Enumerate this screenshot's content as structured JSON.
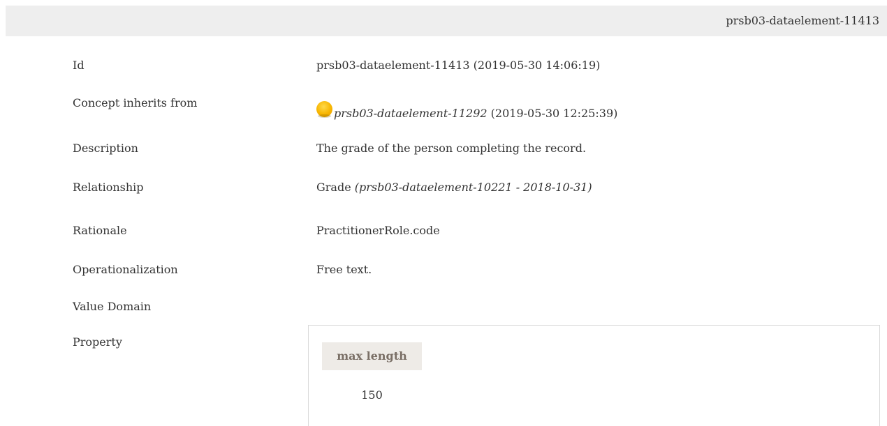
{
  "header": {
    "title": "prsb03-dataelement-11413"
  },
  "rows": {
    "id": {
      "label": "Id",
      "value": "prsb03-dataelement-11413 (2019-05-30 14:06:19)"
    },
    "inherits": {
      "label": "Concept inherits from",
      "status_icon": "status-draft-icon",
      "status_color": "#f7b500",
      "link": "prsb03-dataelement-11292",
      "date": " (2019-05-30 12:25:39)"
    },
    "description": {
      "label": "Description",
      "value": "The grade of the person completing the record."
    },
    "relationship": {
      "label": "Relationship",
      "value": "Grade ",
      "ref": "(prsb03-dataelement-10221 - 2018-10-31)"
    },
    "rationale": {
      "label": "Rationale",
      "value": "PractitionerRole.code"
    },
    "operationalization": {
      "label": "Operationalization",
      "value": "Free text."
    },
    "value_domain": {
      "label": "Value Domain"
    },
    "property": {
      "label": "Property",
      "header": "max length",
      "value": "150"
    }
  }
}
